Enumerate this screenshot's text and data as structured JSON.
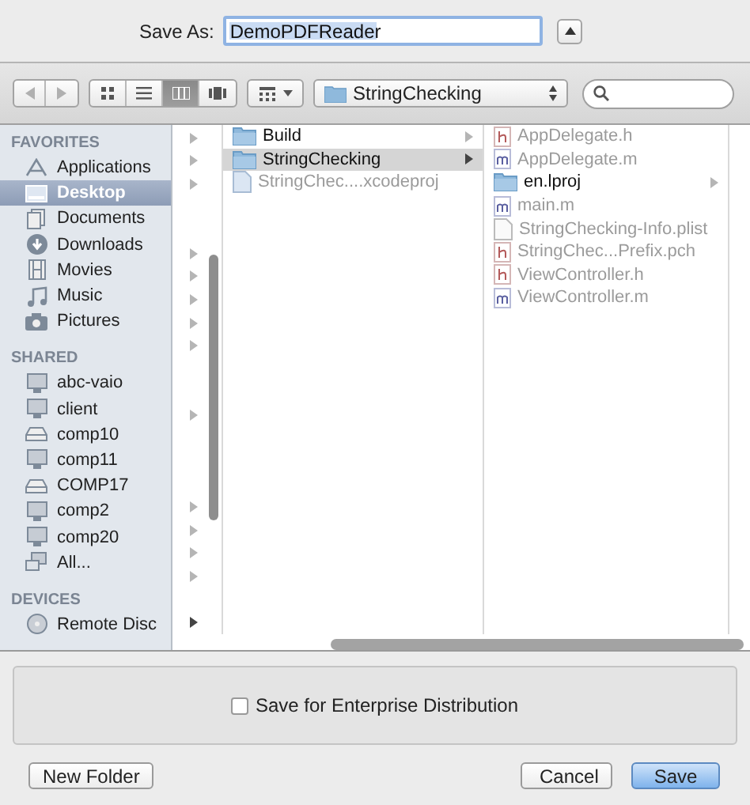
{
  "save_as": {
    "label": "Save As:",
    "value": "DemoPDFReader",
    "text_selected": true
  },
  "toolbar": {
    "back_disabled": true,
    "forward_disabled": true,
    "views": [
      {
        "kind": "icons",
        "selected": false
      },
      {
        "kind": "list",
        "selected": false
      },
      {
        "kind": "columns",
        "selected": true
      },
      {
        "kind": "coverflow",
        "selected": false
      }
    ],
    "path": "StringChecking"
  },
  "sidebar": [
    {
      "heading": "FAVORITES",
      "items": [
        {
          "label": "Applications",
          "kind": "apps",
          "selected": false
        },
        {
          "label": "Desktop",
          "kind": "desktop",
          "selected": true
        },
        {
          "label": "Documents",
          "kind": "documents",
          "selected": false
        },
        {
          "label": "Downloads",
          "kind": "downloads",
          "selected": false
        },
        {
          "label": "Movies",
          "kind": "movies",
          "selected": false
        },
        {
          "label": "Music",
          "kind": "music",
          "selected": false
        },
        {
          "label": "Pictures",
          "kind": "pictures",
          "selected": false
        }
      ]
    },
    {
      "heading": "SHARED",
      "items": [
        {
          "label": "abc-vaio",
          "kind": "monitor",
          "selected": false
        },
        {
          "label": "client",
          "kind": "monitor",
          "selected": false
        },
        {
          "label": "comp10",
          "kind": "server",
          "selected": false
        },
        {
          "label": "comp11",
          "kind": "monitor",
          "selected": false
        },
        {
          "label": "COMP17",
          "kind": "server",
          "selected": false
        },
        {
          "label": "comp2",
          "kind": "monitor",
          "selected": false
        },
        {
          "label": "comp20",
          "kind": "monitor",
          "selected": false
        },
        {
          "label": "All...",
          "kind": "network",
          "selected": false
        }
      ]
    },
    {
      "heading": "DEVICES",
      "items": [
        {
          "label": "Remote Disc",
          "kind": "disc",
          "selected": false
        }
      ]
    }
  ],
  "column_1": [
    {
      "arrow": true,
      "selected": false
    },
    {
      "arrow": true,
      "selected": false
    },
    {
      "arrow": true,
      "selected": false
    },
    {
      "arrow": false
    },
    {
      "arrow": false
    },
    {
      "arrow": true,
      "selected": false
    },
    {
      "arrow": true,
      "selected": false
    },
    {
      "arrow": true,
      "selected": false
    },
    {
      "arrow": true,
      "selected": false
    },
    {
      "arrow": true,
      "selected": false
    },
    {
      "arrow": false
    },
    {
      "arrow": false
    },
    {
      "arrow": true,
      "selected": false
    },
    {
      "arrow": false
    },
    {
      "arrow": false
    },
    {
      "arrow": false
    },
    {
      "arrow": true,
      "selected": false
    },
    {
      "arrow": true,
      "selected": false
    },
    {
      "arrow": true,
      "selected": false
    },
    {
      "arrow": true,
      "selected": false
    },
    {
      "arrow": false
    },
    {
      "arrow": true,
      "selected": true
    }
  ],
  "column_2": [
    {
      "name": "Build",
      "kind": "folder",
      "arrow": true,
      "selected": false,
      "disabled": false
    },
    {
      "name": "StringChecking",
      "kind": "folder",
      "arrow": true,
      "selected": true,
      "disabled": false
    },
    {
      "name": "StringChec....xcodeproj",
      "kind": "project",
      "arrow": false,
      "selected": false,
      "disabled": true
    }
  ],
  "column_3": [
    {
      "name": "AppDelegate.h",
      "kind": "h",
      "arrow": false,
      "selected": false,
      "disabled": true
    },
    {
      "name": "AppDelegate.m",
      "kind": "m",
      "arrow": false,
      "selected": false,
      "disabled": true
    },
    {
      "name": "en.lproj",
      "kind": "folder",
      "arrow": true,
      "selected": false,
      "disabled": false
    },
    {
      "name": "main.m",
      "kind": "m",
      "arrow": false,
      "selected": false,
      "disabled": true
    },
    {
      "name": "StringChecking-Info.plist",
      "kind": "plist",
      "arrow": false,
      "selected": false,
      "disabled": true
    },
    {
      "name": "StringChec...Prefix.pch",
      "kind": "h",
      "arrow": false,
      "selected": false,
      "disabled": true
    },
    {
      "name": "ViewController.h",
      "kind": "h",
      "arrow": false,
      "selected": false,
      "disabled": true
    },
    {
      "name": "ViewController.m",
      "kind": "m",
      "arrow": false,
      "selected": false,
      "disabled": true
    }
  ],
  "options": {
    "checkbox_label": "Save for Enterprise Distribution",
    "checked": false
  },
  "buttons": [
    {
      "label": "New Folder",
      "kind": "plain"
    },
    {
      "label": "Cancel",
      "kind": "plain"
    },
    {
      "label": "Save",
      "kind": "default"
    }
  ]
}
